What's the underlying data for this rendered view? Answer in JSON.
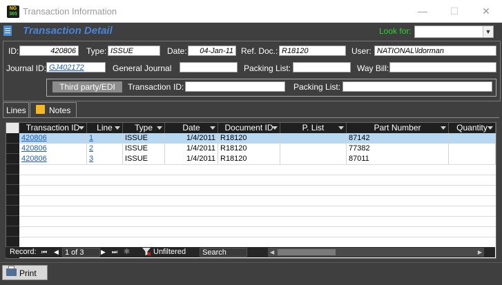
{
  "window": {
    "title": "Transaction Information",
    "logo_top": "NG",
    "logo_bottom": "365",
    "minimize": "—",
    "maximize": "☐",
    "close": "✕"
  },
  "header": {
    "title": "Transaction Detail",
    "lookfor_label": "Look for:",
    "lookfor_value": ""
  },
  "form": {
    "id_label": "ID:",
    "id_value": "420806",
    "type_label": "Type:",
    "type_value": "ISSUE",
    "date_label": "Date:",
    "date_value": "04-Jan-11",
    "ref_label": "Ref. Doc.:",
    "ref_value": "R18120",
    "user_label": "User:",
    "user_value": "NATIONAL\\ldorman",
    "journal_label": "Journal ID:",
    "journal_value": "GJ402172",
    "journal_name": "General Journal",
    "journal_name_value": "",
    "packing_label": "Packing List:",
    "packing_value": "",
    "waybill_label": "Way Bill:",
    "waybill_value": "",
    "thirdparty_button": "Third party/EDI",
    "transaction_label": "Transaction",
    "trans_id_label": "ID:",
    "trans_id_value": "",
    "edi_packing_label": "Packing List:",
    "edi_packing_value": ""
  },
  "tabs": [
    {
      "label": "Lines"
    },
    {
      "label": "Notes"
    }
  ],
  "grid": {
    "columns": [
      "Transaction ID",
      "Line",
      "Type",
      "Date",
      "Document ID",
      "P. List",
      "Part Number",
      "Quantity"
    ],
    "rows": [
      {
        "transaction_id": "420806",
        "line": "1",
        "type": "ISSUE",
        "date": "1/4/2011",
        "document_id": "R18120",
        "plist": "",
        "part_number": "87142",
        "quantity": ""
      },
      {
        "transaction_id": "420806",
        "line": "2",
        "type": "ISSUE",
        "date": "1/4/2011",
        "document_id": "R18120",
        "plist": "",
        "part_number": "77382",
        "quantity": ""
      },
      {
        "transaction_id": "420806",
        "line": "3",
        "type": "ISSUE",
        "date": "1/4/2011",
        "document_id": "R18120",
        "plist": "",
        "part_number": "87011",
        "quantity": ""
      }
    ]
  },
  "navigator": {
    "record_label": "Record:",
    "record_value": "1 of 3",
    "first": "⏮",
    "prev": "◀",
    "next": "▶",
    "last": "⏭",
    "new": "✱",
    "filter_status": "Unfiltered",
    "search_placeholder": "Search"
  },
  "footer": {
    "print_label": "Print"
  }
}
